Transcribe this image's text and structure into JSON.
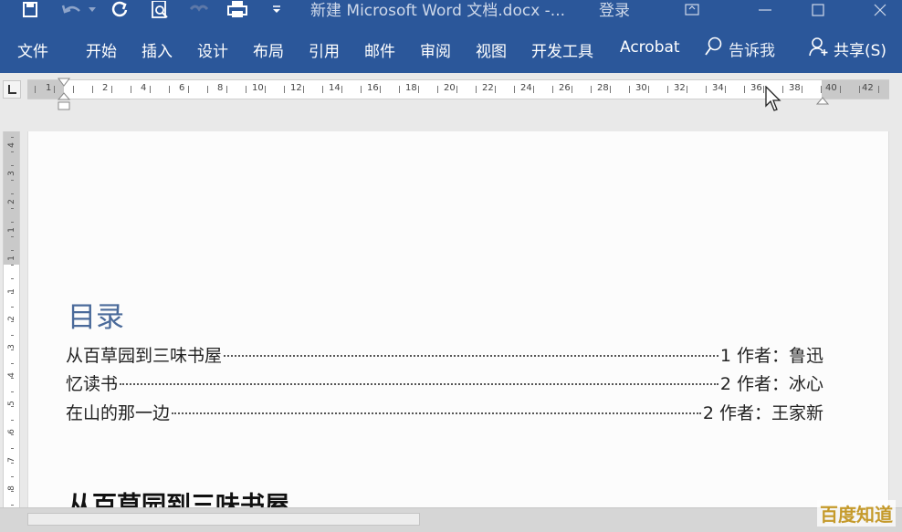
{
  "title_bar": {
    "doc_title": "新建 Microsoft Word 文档.docx  -...",
    "login": "登录",
    "bg": "#2b579a"
  },
  "quick_access": [
    "save-icon",
    "undo-icon",
    "redo-icon",
    "print-preview-icon",
    "touch-mode-icon",
    "print-icon",
    "customize-icon"
  ],
  "ribbon": {
    "tabs": [
      {
        "label": "文件"
      },
      {
        "label": "开始"
      },
      {
        "label": "插入"
      },
      {
        "label": "设计"
      },
      {
        "label": "布局"
      },
      {
        "label": "引用"
      },
      {
        "label": "邮件"
      },
      {
        "label": "审阅"
      },
      {
        "label": "视图"
      },
      {
        "label": "开发工具"
      },
      {
        "label": "Acrobat"
      }
    ],
    "tell_me": "告诉我",
    "share": "共享(S)"
  },
  "ruler": {
    "horizontal_labels": [
      "1",
      "2",
      "4",
      "6",
      "8",
      "10",
      "12",
      "14",
      "16",
      "18",
      "20",
      "22",
      "24",
      "26",
      "28",
      "30",
      "32",
      "34",
      "36",
      "38",
      "40",
      "42"
    ],
    "vertical_labels": [
      "4",
      "3",
      "2",
      "1",
      "1",
      "1",
      "2",
      "3",
      "4",
      "5",
      "6",
      "7",
      "8"
    ]
  },
  "document": {
    "toc_heading": "目录",
    "toc": [
      {
        "entry": "从百草园到三味书屋",
        "page_ref": "1 作者：鲁迅"
      },
      {
        "entry": "忆读书",
        "page_ref": "2 作者：冰心"
      },
      {
        "entry": "在山的那一边",
        "page_ref": "2 作者：王家新"
      }
    ],
    "section_heading": "从百草园到三味书屋"
  },
  "watermark": "百度知道"
}
